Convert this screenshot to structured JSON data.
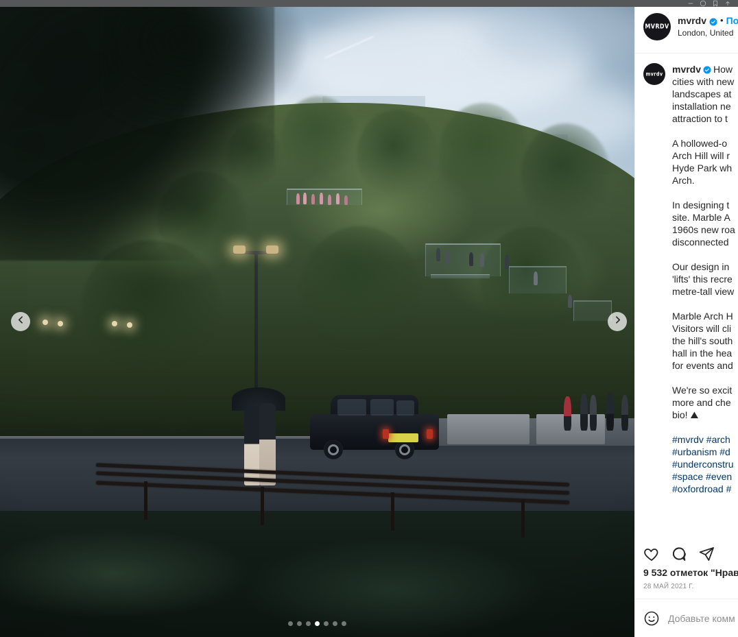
{
  "browser": {
    "icons": [
      "up-arrow-icon",
      "bookmark-icon",
      "account-circle-icon",
      "menu-icon"
    ]
  },
  "post": {
    "header": {
      "avatar_mark": "MVRDV",
      "username": "mvrdv",
      "verified_icon": "verified-badge-icon",
      "separator": "•",
      "follow_label": "По",
      "location": "London, United"
    },
    "caption": {
      "username": "mvrdv",
      "verified_icon": "verified-badge-icon",
      "paragraphs": [
        [
          "How",
          "cities with new",
          "landscapes at",
          "installation ne",
          "attraction to t"
        ],
        [
          "A hollowed-o",
          "Arch Hill will r",
          "Hyde Park wh",
          "Arch."
        ],
        [
          "In designing t",
          "site. Marble A",
          "1960s new roa",
          "disconnected"
        ],
        [
          "Our design in",
          "'lifts' this recre",
          "metre-tall view"
        ],
        [
          "Marble Arch H",
          "Visitors will cli",
          "the hill's south",
          "hall in the hea",
          "for events and"
        ],
        [
          "We're so excit",
          "more and che",
          "bio! ⛰"
        ]
      ],
      "hashtags": [
        "#mvrdv #arch",
        "#urbanism #d",
        "#underconstru",
        "#space #even",
        "#oxfordroad #"
      ]
    },
    "actions": [
      {
        "name": "like-button",
        "icon": "heart-icon"
      },
      {
        "name": "comment-button",
        "icon": "speech-bubble-icon"
      },
      {
        "name": "share-button",
        "icon": "paper-plane-icon"
      }
    ],
    "likes": "9 532 отметок \"Нрав",
    "date": "28 МАЙ 2021 Г.",
    "comment": {
      "emoji_icon": "smiley-face-icon",
      "placeholder": "Добавьте комм"
    },
    "carousel": {
      "prev_icon": "chevron-left-icon",
      "next_icon": "chevron-right-icon",
      "dot_count": 7,
      "active_dot": 3
    }
  },
  "colors": {
    "accent": "#0095f6",
    "link": "#00376b",
    "text": "#262626",
    "muted": "#8e8e8e",
    "border": "#efefef"
  }
}
